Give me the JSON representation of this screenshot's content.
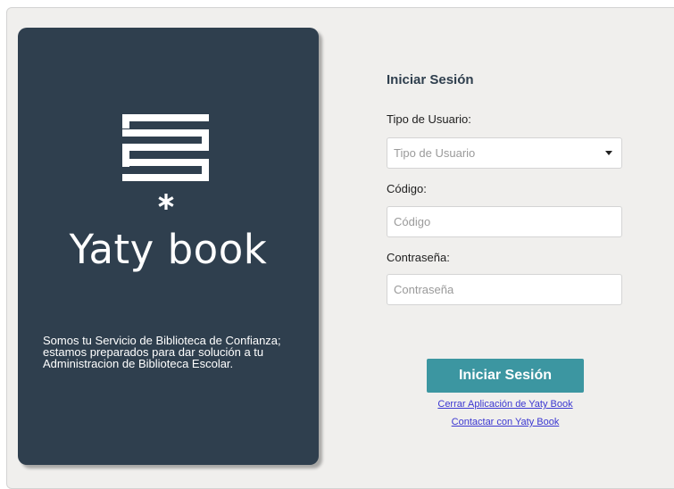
{
  "brand": {
    "name": "Yaty book",
    "tagline": "Somos tu Servicio de Biblioteca de Confianza; estamos preparados para dar solución a tu Administracion de Biblioteca Escolar.",
    "panel_color": "#2f3f4e",
    "logo_icon": "stacked-books-icon"
  },
  "login": {
    "title": "Iniciar Sesión",
    "user_type": {
      "label": "Tipo de Usuario:",
      "placeholder": "Tipo de Usuario",
      "icon": "chevron-down-icon"
    },
    "code": {
      "label": "Código:",
      "placeholder": "Código"
    },
    "password": {
      "label": "Contraseña:",
      "placeholder": "Contraseña"
    },
    "submit_label": "Iniciar Sesión",
    "accent_color": "#3c96a1",
    "links": {
      "close_app": "Cerrar Aplicación de Yaty Book",
      "contact": "Contactar con Yaty Book"
    }
  }
}
